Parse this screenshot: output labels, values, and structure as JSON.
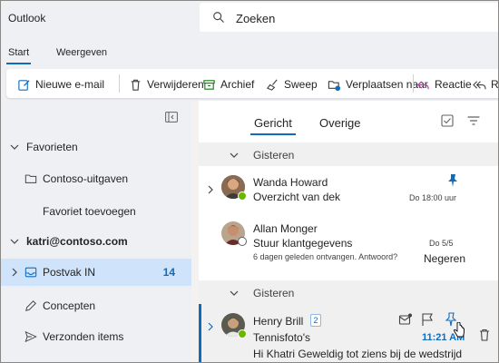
{
  "app": {
    "title": "Outlook"
  },
  "search": {
    "text": "Zoeken"
  },
  "ribbon_tabs": [
    {
      "label": "Start"
    },
    {
      "label": "Weergeven"
    }
  ],
  "toolbar": {
    "new_mail": "Nieuwe e-mail",
    "delete": "Verwijderen",
    "archive": "Archief",
    "sweep": "Sweep",
    "move": "Verplaatsen naar",
    "react": "Reactie",
    "reply_all": "R"
  },
  "nav": {
    "favorites": "Favorieten",
    "folder_contoso": "Contoso-uitgaven",
    "add_favorite": "Favoriet toevoegen",
    "account": "katri@contoso.com",
    "inbox": "Postvak IN",
    "inbox_count": "14",
    "drafts": "Concepten",
    "sent": "Verzonden items"
  },
  "list": {
    "tab_focused": "Gericht",
    "tab_other": "Overige",
    "group1": "Gisteren",
    "group2": "Gisteren",
    "messages": [
      {
        "sender": "Wanda Howard",
        "subject": "Overzicht van dek",
        "time": "Do 18:00 uur"
      },
      {
        "sender": "Allan Monger",
        "subject": "Stuur klantgegevens",
        "preview": "6 dagen geleden ontvangen. Antwoord?",
        "time": "Do 5/5",
        "action": "Negeren"
      },
      {
        "sender": "Henry Brill",
        "badge": "2",
        "subject": "Tennisfoto's",
        "preview": "Hi Khatri Geweldig tot ziens bij de wedstrijd",
        "time": "11:21 AM"
      }
    ]
  },
  "colors": {
    "accent": "#0f6cbd",
    "selected_nav": "#cfe4fa",
    "presence": "#6bb700"
  }
}
